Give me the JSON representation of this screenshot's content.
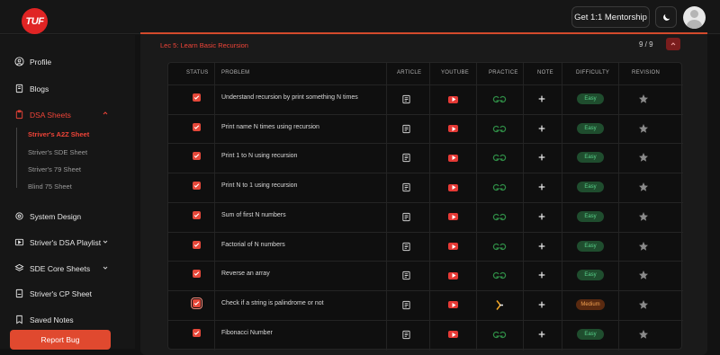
{
  "topbar": {
    "logo": "TUF",
    "mentorship_label": "Get 1:1 Mentorship",
    "theme_icon": "moon-icon",
    "avatar_icon": "user-avatar-icon"
  },
  "sidebar": {
    "items": [
      {
        "label": "Profile",
        "icon": "user-circle-icon"
      },
      {
        "label": "Blogs",
        "icon": "book-icon"
      },
      {
        "label": "DSA Sheets",
        "icon": "clipboard-icon"
      },
      {
        "label": "System Design",
        "icon": "gear-icon"
      },
      {
        "label": "Striver's DSA Playlist",
        "icon": "play-icon"
      },
      {
        "label": "SDE Core Sheets",
        "icon": "layers-icon"
      },
      {
        "label": "Striver's CP Sheet",
        "icon": "file-icon"
      },
      {
        "label": "Saved Notes",
        "icon": "bookmark-icon"
      }
    ],
    "sub_items": [
      "Striver's A2Z Sheet",
      "Striver's SDE Sheet",
      "Striver's 79 Sheet",
      "Blind 75 Sheet"
    ],
    "report_label": "Report Bug"
  },
  "section": {
    "title": "Lec 5: Learn Basic Recursion",
    "count": "9 / 9"
  },
  "table": {
    "headers": [
      "STATUS",
      "PROBLEM",
      "ARTICLE",
      "YOUTUBE",
      "PRACTICE",
      "NOTE",
      "DIFFICULTY",
      "REVISION"
    ],
    "rows": [
      {
        "problem": "Understand recursion by print something N times",
        "difficulty": "Easy",
        "practice": "gfg"
      },
      {
        "problem": "Print name N times using recursion",
        "difficulty": "Easy",
        "practice": "gfg"
      },
      {
        "problem": "Print 1 to N using recursion",
        "difficulty": "Easy",
        "practice": "gfg"
      },
      {
        "problem": "Print N to 1 using recursion",
        "difficulty": "Easy",
        "practice": "gfg"
      },
      {
        "problem": "Sum of first N numbers",
        "difficulty": "Easy",
        "practice": "gfg"
      },
      {
        "problem": "Factorial of N numbers",
        "difficulty": "Easy",
        "practice": "gfg"
      },
      {
        "problem": "Reverse an array",
        "difficulty": "Easy",
        "practice": "gfg"
      },
      {
        "problem": "Check if a string is palindrome or not",
        "difficulty": "Medium",
        "practice": "codestudio"
      },
      {
        "problem": "Fibonacci Number",
        "difficulty": "Easy",
        "practice": "gfg"
      }
    ]
  },
  "colors": {
    "accent": "#e5483a",
    "easy": "#58d08a",
    "medium": "#f0a050",
    "gfg": "#2f8d46"
  }
}
